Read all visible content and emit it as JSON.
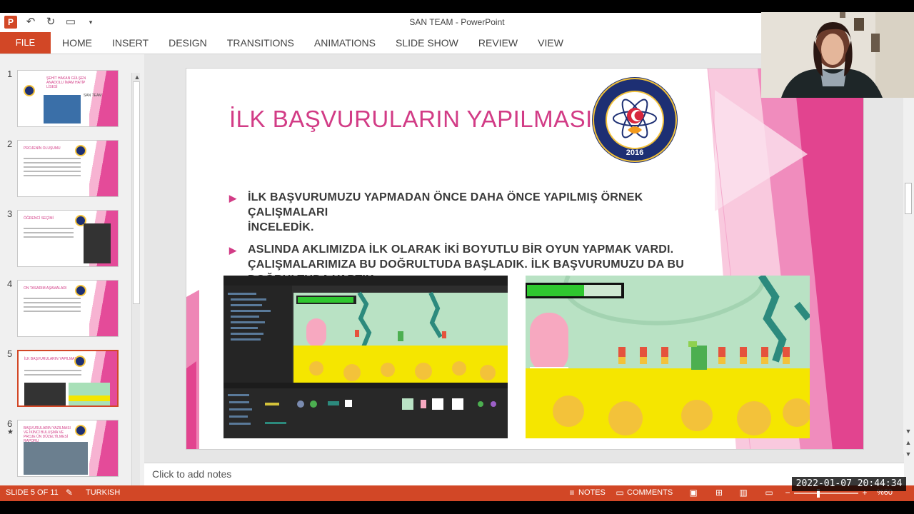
{
  "window": {
    "title": "SAN TEAM - PowerPoint"
  },
  "colors": {
    "accent": "#d24726",
    "slide_pink": "#d23c86",
    "emblem_navy": "#1d2f73",
    "emblem_gold": "#f3c23a"
  },
  "ribbon": {
    "file": "FILE",
    "tabs": [
      "HOME",
      "INSERT",
      "DESIGN",
      "TRANSITIONS",
      "ANIMATIONS",
      "SLIDE SHOW",
      "REVIEW",
      "VIEW"
    ]
  },
  "thumbnails": [
    {
      "num": "1",
      "title": "ŞEHİT HAKAN GÜLŞEN ANADOLU İMAM HATİP LİSESİ",
      "sub": "SAN TEAM"
    },
    {
      "num": "2",
      "title": "PROJENİN OLUŞUMU"
    },
    {
      "num": "3",
      "title": "ÖĞRENCİ SEÇİMİ"
    },
    {
      "num": "4",
      "title": "ON TASARIM AŞAMALARI"
    },
    {
      "num": "5",
      "title": "İLK BAŞVURULARIN YAPILMASI",
      "selected": true
    },
    {
      "num": "6",
      "title": "BAŞVURULARIN YAZILMASI VE İKİNCİ BULUŞMA VE PROJE ÜN DÜZELTİLMESİ RAPORU",
      "star": "★"
    }
  ],
  "slide": {
    "title": "İLK BAŞVURULARIN YAPILMASI",
    "emblem_text": "ŞEHİT HAKAN GÜLŞEN ANADOLU İMAM HATİP LİSESİ",
    "emblem_year": "2016",
    "bullets": [
      [
        "İLK BAŞVURUMUZU YAPMADAN ÖNCE DAHA ÖNCE YAPILMIŞ ÖRNEK ÇALIŞMALARI",
        "İNCELEDİK."
      ],
      [
        "ASLINDA AKLIMIZDA İLK OLARAK İKİ BOYUTLU BİR OYUN YAPMAK VARDI.",
        "ÇALIŞMALARIMIZA BU DOĞRULTUDA BAŞLADIK. İLK BAŞVURUMUZU DA BU",
        "DOĞRULTUDA YAPTIK."
      ]
    ]
  },
  "notes": {
    "placeholder": "Click to add notes"
  },
  "statusbar": {
    "slide": "SLIDE 5 OF 11",
    "language": "TURKISH",
    "notes": "NOTES",
    "comments": "COMMENTS",
    "zoom": "%60"
  },
  "overlay": {
    "timestamp": "2022-01-07 20:44:34"
  }
}
